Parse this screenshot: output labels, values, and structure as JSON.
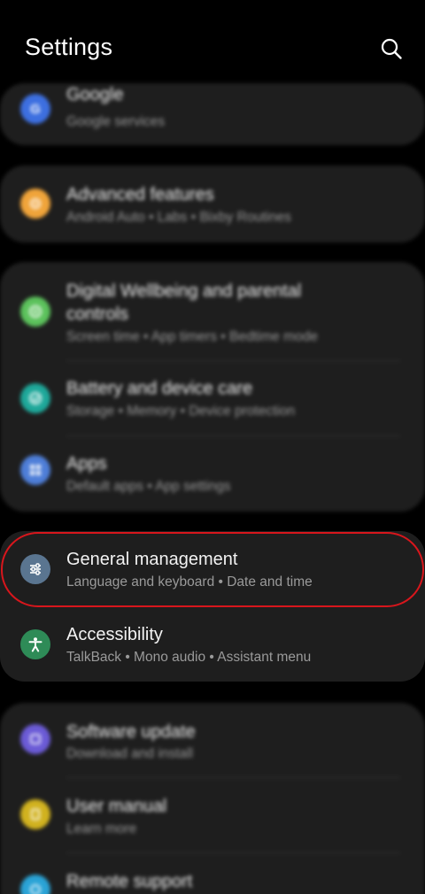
{
  "header": {
    "title": "Settings",
    "search_icon": "search-icon"
  },
  "groups": [
    {
      "items": [
        {
          "label": "Google",
          "sub": "Google services",
          "icon": "google-icon",
          "color": "#3d6fe0"
        }
      ]
    },
    {
      "items": [
        {
          "label": "Advanced features",
          "sub": "Android Auto • Labs • Bixby Routines",
          "icon": "gear-plus-icon",
          "color": "#f0a43a"
        }
      ]
    },
    {
      "items": [
        {
          "label_line1": "Digital Wellbeing and parental",
          "label_line2": "controls",
          "sub": "Screen time • App timers • Bedtime mode",
          "icon": "wellbeing-icon",
          "color": "#5cc25c"
        },
        {
          "label": "Battery and device care",
          "sub": "Storage • Memory • Device protection",
          "icon": "device-care-icon",
          "color": "#1ea89a"
        },
        {
          "label": "Apps",
          "sub": "Default apps • App settings",
          "icon": "apps-icon",
          "color": "#4e7ed8"
        }
      ]
    },
    {
      "items": [
        {
          "label": "General management",
          "sub": "Language and keyboard • Date and time",
          "icon": "sliders-icon",
          "color": "#5a7590"
        },
        {
          "label": "Accessibility",
          "sub": "TalkBack • Mono audio • Assistant menu",
          "icon": "accessibility-icon",
          "color": "#2e8b57"
        }
      ]
    },
    {
      "items": [
        {
          "label": "Software update",
          "sub": "Download and install",
          "icon": "software-update-icon",
          "color": "#6b5bd6"
        },
        {
          "label": "User manual",
          "sub": "Learn more",
          "icon": "manual-icon",
          "color": "#d1b21f"
        },
        {
          "label": "Remote support",
          "icon": "remote-support-icon",
          "color": "#2aa3d6"
        }
      ]
    }
  ]
}
